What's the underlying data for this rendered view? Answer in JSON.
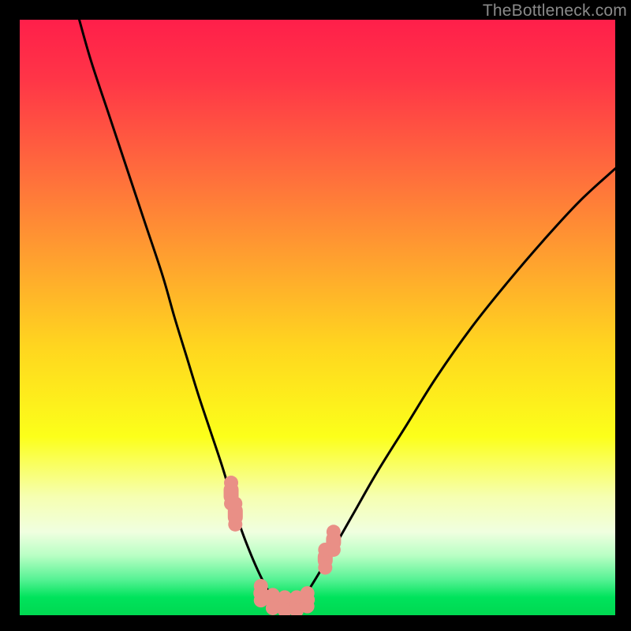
{
  "watermark": "TheBottleneck.com",
  "colors": {
    "bg_black": "#000000",
    "curve": "#000000",
    "marker_fill": "#e98f86",
    "marker_stroke": "#e98f86",
    "green_band": "#00e35c"
  },
  "chart_data": {
    "type": "line",
    "title": "",
    "xlabel": "",
    "ylabel": "",
    "xlim": [
      0,
      100
    ],
    "ylim": [
      0,
      100
    ],
    "gradient_stops": [
      {
        "offset": 0.0,
        "color": "#ff1f4a"
      },
      {
        "offset": 0.1,
        "color": "#ff3547"
      },
      {
        "offset": 0.25,
        "color": "#ff6a3d"
      },
      {
        "offset": 0.4,
        "color": "#ffa02f"
      },
      {
        "offset": 0.55,
        "color": "#ffd61f"
      },
      {
        "offset": 0.7,
        "color": "#fcff1a"
      },
      {
        "offset": 0.8,
        "color": "#f6ffb0"
      },
      {
        "offset": 0.86,
        "color": "#f0ffe0"
      },
      {
        "offset": 0.9,
        "color": "#b8ffc4"
      },
      {
        "offset": 0.94,
        "color": "#56f294"
      },
      {
        "offset": 0.97,
        "color": "#00e35c"
      },
      {
        "offset": 1.0,
        "color": "#00d851"
      }
    ],
    "series": [
      {
        "name": "curve-left",
        "x": [
          10,
          12,
          15,
          18,
          21,
          24,
          26,
          28,
          30,
          32,
          34,
          35.5,
          37,
          38.5,
          40,
          41.5,
          43
        ],
        "values": [
          100,
          93,
          84,
          75,
          66,
          57,
          50,
          43.5,
          37,
          31,
          25,
          20,
          15,
          11,
          7.5,
          4.5,
          2
        ]
      },
      {
        "name": "curve-right",
        "x": [
          47,
          49,
          52,
          56,
          60,
          65,
          70,
          76,
          82,
          88,
          94,
          100
        ],
        "values": [
          2,
          5,
          10,
          17,
          24,
          32,
          40,
          48.5,
          56,
          63,
          69.5,
          75
        ]
      }
    ],
    "flat_bottom": {
      "x0": 43,
      "x1": 47,
      "y": 2
    },
    "markers": [
      {
        "x": 35.5,
        "y": 20.5,
        "vlen": 3.5
      },
      {
        "x": 36.2,
        "y": 17.0,
        "vlen": 3.5
      },
      {
        "x": 40.5,
        "y": 3.7,
        "vlen": 2.4
      },
      {
        "x": 42.5,
        "y": 2.3,
        "vlen": 2.2
      },
      {
        "x": 44.5,
        "y": 1.9,
        "vlen": 2.2
      },
      {
        "x": 46.5,
        "y": 1.9,
        "vlen": 2.2
      },
      {
        "x": 48.3,
        "y": 2.6,
        "vlen": 2.2
      },
      {
        "x": 51.3,
        "y": 9.5,
        "vlen": 3.0
      },
      {
        "x": 52.7,
        "y": 12.5,
        "vlen": 3.0
      }
    ]
  }
}
